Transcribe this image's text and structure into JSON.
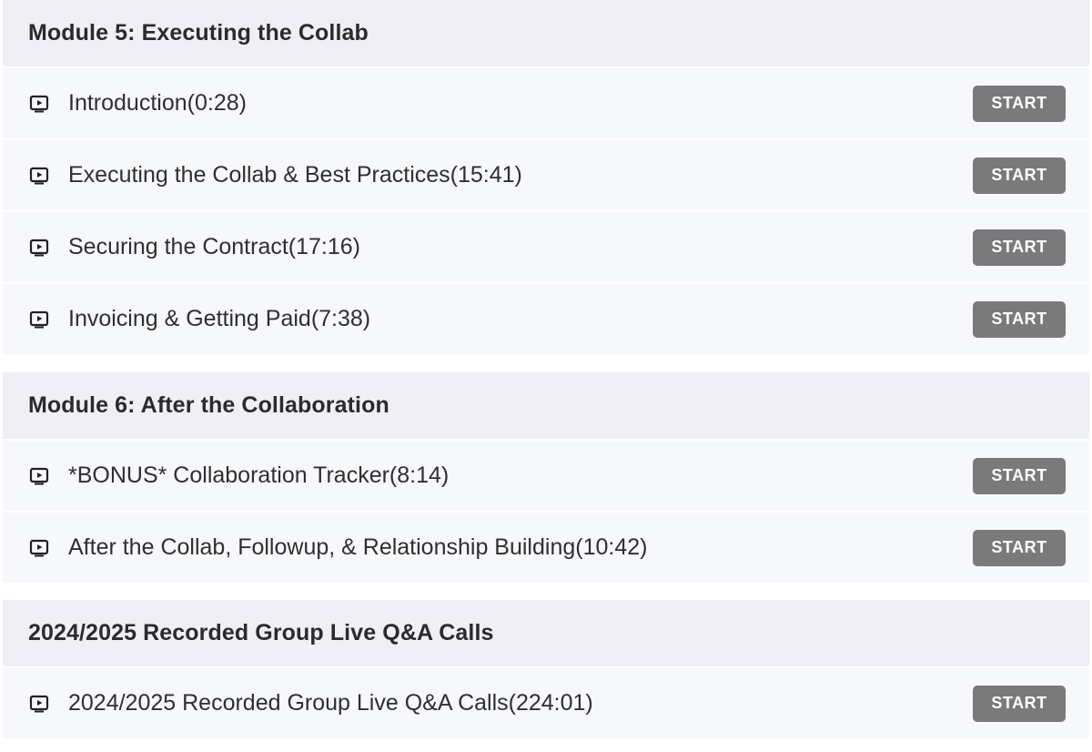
{
  "sections": [
    {
      "title": "Module 5: Executing the Collab",
      "lessons": [
        {
          "title": "Introduction(0:28)",
          "button": "START",
          "icon": "video-icon"
        },
        {
          "title": "Executing the Collab & Best Practices(15:41)",
          "button": "START",
          "icon": "video-icon"
        },
        {
          "title": "Securing the Contract(17:16)",
          "button": "START",
          "icon": "video-icon"
        },
        {
          "title": "Invoicing & Getting Paid(7:38)",
          "button": "START",
          "icon": "video-icon"
        }
      ]
    },
    {
      "title": "Module 6: After the Collaboration",
      "lessons": [
        {
          "title": "*BONUS* Collaboration Tracker(8:14)",
          "button": "START",
          "icon": "video-icon"
        },
        {
          "title": "After the Collab, Followup, & Relationship Building(10:42)",
          "button": "START",
          "icon": "video-icon"
        }
      ]
    },
    {
      "title": "2024/2025 Recorded Group Live Q&A Calls",
      "lessons": [
        {
          "title": "2024/2025 Recorded Group Live Q&A Calls(224:01)",
          "button": "START",
          "icon": "video-icon"
        }
      ]
    }
  ],
  "colors": {
    "section_header_bg": "#f0eff5",
    "lesson_bg": "#f7f8fb",
    "button_bg": "#7a7a7a",
    "button_text": "#ffffff",
    "text": "#2f2f2f"
  }
}
